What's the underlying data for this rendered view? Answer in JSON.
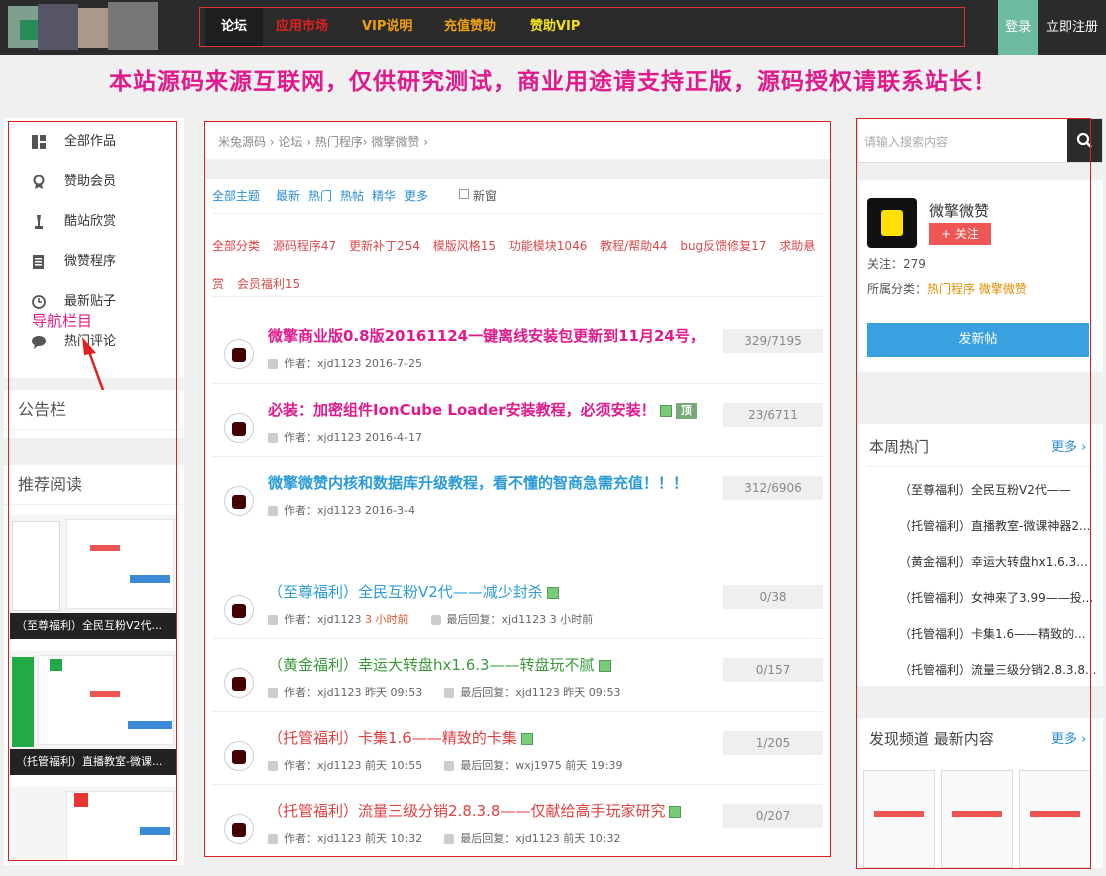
{
  "nav": {
    "items": [
      {
        "label": "论坛",
        "color": "#ffffff"
      },
      {
        "label": "应用市场",
        "color": "#e02020"
      },
      {
        "label": "VIP说明",
        "color": "#f0a010"
      },
      {
        "label": "充值赞助",
        "color": "#f0a010"
      },
      {
        "label": "赞助VIP",
        "color": "#f0e020"
      }
    ],
    "login": "登录",
    "register": "立即注册"
  },
  "banner": "本站源码来源互联网，仅供研究测试，商业用途请支持正版，源码授权请联系站长！",
  "sidebar": {
    "items": [
      {
        "label": "全部作品",
        "icon": "grid-icon"
      },
      {
        "label": "赞助会员",
        "icon": "badge-icon"
      },
      {
        "label": "酷站欣赏",
        "icon": "trophy-icon"
      },
      {
        "label": "微赞程序",
        "icon": "document-icon"
      },
      {
        "label": "最新贴子",
        "icon": "clock-icon"
      },
      {
        "label": "热门评论",
        "icon": "comment-icon"
      }
    ],
    "annotation": "导航栏目",
    "notice_title": "公告栏",
    "recommend_title": "推荐阅读",
    "recommend": [
      {
        "caption": "（至尊福利）全民互粉V2代..."
      },
      {
        "caption": "（托管福利）直播教室-微课..."
      }
    ]
  },
  "main": {
    "breadcrumb": "米兔源码 › 论坛 › 热门程序› 微擎微赞 ›",
    "filters": [
      "全部主题",
      "最新",
      "热门",
      "热帖",
      "精华",
      "更多"
    ],
    "new_window": "新窗",
    "categories": [
      {
        "label": "全部分类",
        "active": true
      },
      {
        "label": "源码程序47"
      },
      {
        "label": "更新补丁254"
      },
      {
        "label": "模版风格15"
      },
      {
        "label": "功能模块1046"
      },
      {
        "label": "教程/帮助44"
      },
      {
        "label": "bug反馈修复17"
      },
      {
        "label": "求助悬赏"
      },
      {
        "label": "会员福利15"
      }
    ],
    "sticky": [
      {
        "title": "微擎商业版0.8版20161124一键离线安装包更新到11月24号，",
        "color": "#e0198c",
        "meta": "作者：xjd1123 2016-7-25",
        "count": "329/7195"
      },
      {
        "title": "必装：加密组件IonCube Loader安装教程，必须安装！",
        "color": "#e0198c",
        "meta": "作者：xjd1123 2016-4-17",
        "count": "23/6711",
        "badge": "顶"
      },
      {
        "title": "微擎微赞内核和数据库升级教程，看不懂的智商急需充值！！！",
        "color": "#2a8bd8",
        "meta": "作者：xjd1123 2016-3-4",
        "count": "312/6906"
      }
    ],
    "threads": [
      {
        "title": "（至尊福利）全民互粉V2代——减少封杀",
        "color": "#2a9bd8",
        "author": "作者：xjd1123",
        "time": "3 小时前",
        "reply": "最后回复：xjd1123 3 小时前",
        "count": "0/38"
      },
      {
        "title": "（黄金福利）幸运大转盘hx1.6.3——转盘玩不腻",
        "color": "#3a9a3a",
        "author": "作者：xjd1123 昨天 09:53",
        "reply": "最后回复：xjd1123 昨天 09:53",
        "count": "0/157"
      },
      {
        "title": "（托管福利）卡集1.6——精致的卡集",
        "color": "#e04040",
        "author": "作者：xjd1123 前天 10:55",
        "reply": "最后回复：wxj1975 前天 19:39",
        "count": "1/205"
      },
      {
        "title": "（托管福利）流量三级分销2.8.3.8——仅献给高手玩家研究",
        "color": "#e04040",
        "author": "作者：xjd1123 前天 10:32",
        "reply": "最后回复：xjd1123 前天 10:32",
        "count": "0/207"
      }
    ]
  },
  "right": {
    "search_placeholder": "请输入搜索内容",
    "forum_name": "微擎微赞",
    "follow": "+ 关注",
    "follow_count": "关注：279",
    "category_label": "所属分类：",
    "category_value": "热门程序 微擎微赞",
    "post_button": "发新帖",
    "hot_title": "本周热门",
    "more": "更多",
    "hot_items": [
      "（至尊福利）全民互粉V2代——",
      "（托管福利）直播教室-微课神器2...",
      "（黄金福利）幸运大转盘hx1.6.3...",
      "（托管福利）女神来了3.99——投...",
      "（托管福利）卡集1.6——精致的...",
      "（托管福利）流量三级分销2.8.3.8..."
    ],
    "discover_title": "发现频道 最新内容"
  }
}
